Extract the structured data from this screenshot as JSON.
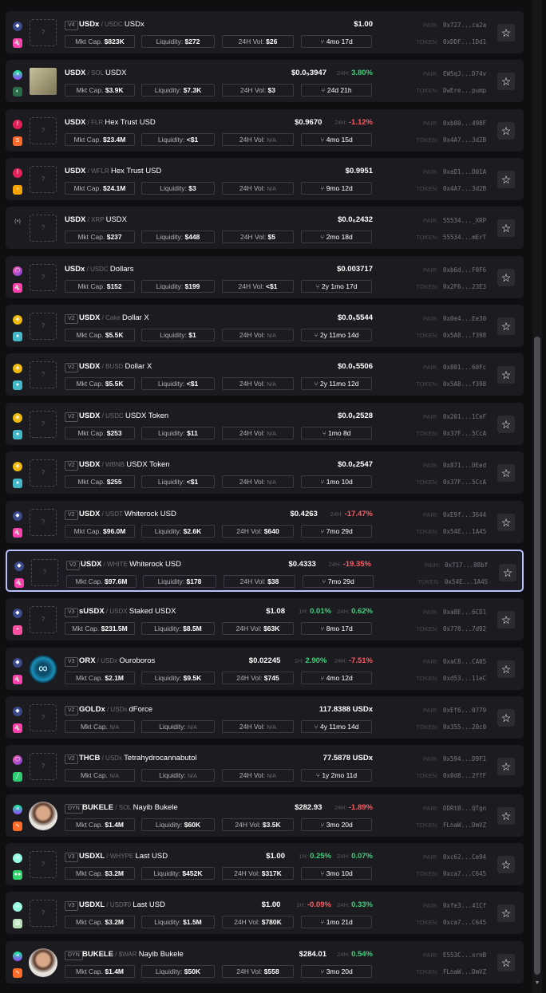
{
  "labels": {
    "mkt_cap": "Mkt Cap.",
    "liquidity": "Liquidity:",
    "vol": "24H Vol:",
    "pair": "PAIR:",
    "token": "TOKEN:",
    "h1": "1H:",
    "h24": "24H:",
    "na": "N/A",
    "separator": "/"
  },
  "colors": {
    "positive": "#3ecf7a",
    "negative": "#ff5b61",
    "selected_border": "#b8c2ff"
  },
  "rows": [
    {
      "chain": "ethereum-icon",
      "dex": "uniswap-icon",
      "logo": "placeholder",
      "version": "V4",
      "base": "USDx",
      "quote": "USDC",
      "name": "USDx",
      "price": "$1.00",
      "h1": null,
      "h24": null,
      "mcap": "$823K",
      "liq": "$272",
      "vol": "$26",
      "age": "4mo 17d",
      "pair": "0x727...ca2a",
      "token": "0xDDF...1Dd1",
      "selected": false
    },
    {
      "chain": "solana-icon",
      "dex": "pumpswap-icon",
      "logo": "banknote-image",
      "version": null,
      "base": "USDX",
      "quote": "SOL",
      "name": "USDX",
      "price": "$0.0₅3947",
      "h1": null,
      "h24": "3.80%",
      "h24_dir": "up",
      "mcap": "$3.9K",
      "liq": "$7.3K",
      "vol": "$3",
      "age": "24d 21h",
      "pair": "EW5qJ...D74v",
      "token": "DwEre...pump",
      "selected": false
    },
    {
      "chain": "flare-icon",
      "dex": "sparkdex-icon",
      "logo": "placeholder",
      "version": null,
      "base": "USDX",
      "quote": "FLR",
      "name": "Hex Trust USD",
      "price": "$0.9670",
      "h1": null,
      "h24": "-1.12%",
      "h24_dir": "down",
      "mcap": "$23.4M",
      "liq": "<$1",
      "vol": "N/A",
      "age": "4mo 15d",
      "pair": "0xb80...498F",
      "token": "0x4A7...3d2B",
      "selected": false
    },
    {
      "chain": "flare-icon",
      "dex": "blazeswap-icon",
      "logo": "placeholder",
      "version": null,
      "base": "USDX",
      "quote": "WFLR",
      "name": "Hex Trust USD",
      "price": "$0.9951",
      "h1": null,
      "h24": null,
      "mcap": "$24.1M",
      "liq": "$3",
      "vol": "N/A",
      "age": "9mo 12d",
      "pair": "0xeD1...D01A",
      "token": "0x4A7...3d2B",
      "selected": false
    },
    {
      "chain": "xrp-icon",
      "dex": null,
      "logo": "placeholder",
      "version": null,
      "base": "USDX",
      "quote": "XRP",
      "name": "USDX",
      "price": "$0.0₆2432",
      "h1": null,
      "h24": null,
      "mcap": "$237",
      "liq": "$448",
      "vol": "$5",
      "age": "2mo 18d",
      "pair": "55534..._XRP",
      "token": "55534...mErT",
      "selected": false
    },
    {
      "chain": "polygon-icon",
      "dex": "uniswap-icon",
      "logo": "placeholder",
      "version": null,
      "base": "USDx",
      "quote": "USDC",
      "name": "Dollars",
      "price": "$0.003717",
      "h1": null,
      "h24": null,
      "mcap": "$152",
      "liq": "$199",
      "vol": "<$1",
      "age": "2y 1mo 17d",
      "pair": "0xb6d...F0F6",
      "token": "0x2F6...23E3",
      "selected": false
    },
    {
      "chain": "bnb-icon",
      "dex": "pancakeswap-icon",
      "logo": "placeholder",
      "version": "V2",
      "base": "USDX",
      "quote": "Cake",
      "name": "Dollar X",
      "price": "$0.0₅5544",
      "h1": null,
      "h24": null,
      "mcap": "$5.5K",
      "liq": "$1",
      "vol": "N/A",
      "age": "2y 11mo 14d",
      "pair": "0x0e4...Ee30",
      "token": "0x5A8...f398",
      "selected": false
    },
    {
      "chain": "bnb-icon",
      "dex": "pancakeswap-icon",
      "logo": "placeholder",
      "version": "V2",
      "base": "USDX",
      "quote": "BUSD",
      "name": "Dollar X",
      "price": "$0.0₅5506",
      "h1": null,
      "h24": null,
      "mcap": "$5.5K",
      "liq": "<$1",
      "vol": "N/A",
      "age": "2y 11mo 12d",
      "pair": "0x801...60Fc",
      "token": "0x5A8...f398",
      "selected": false
    },
    {
      "chain": "bnb-icon",
      "dex": "pancakeswap-icon",
      "logo": "placeholder",
      "version": "V2",
      "base": "USDX",
      "quote": "USDC",
      "name": "USDX Token",
      "price": "$0.0₆2528",
      "h1": null,
      "h24": null,
      "mcap": "$253",
      "liq": "$11",
      "vol": "N/A",
      "age": "1mo 8d",
      "pair": "0x201...1CeF",
      "token": "0x37F...5CcA",
      "selected": false
    },
    {
      "chain": "bnb-icon",
      "dex": "pancakeswap-icon",
      "logo": "placeholder",
      "version": "V2",
      "base": "USDX",
      "quote": "WBNB",
      "name": "USDX Token",
      "price": "$0.0₆2547",
      "h1": null,
      "h24": null,
      "mcap": "$255",
      "liq": "<$1",
      "vol": "N/A",
      "age": "1mo 10d",
      "pair": "0x871...DEed",
      "token": "0x37F...5CcA",
      "selected": false
    },
    {
      "chain": "ethereum-icon",
      "dex": "uniswap-icon",
      "logo": "placeholder",
      "version": "V2",
      "base": "USDX",
      "quote": "USDT",
      "name": "Whiterock USD",
      "price": "$0.4263",
      "h1": null,
      "h24": "-17.47%",
      "h24_dir": "down",
      "mcap": "$96.0M",
      "liq": "$2.6K",
      "vol": "$640",
      "age": "7mo 29d",
      "pair": "0xE9f...3644",
      "token": "0x54E...1A45",
      "selected": false
    },
    {
      "chain": "ethereum-icon",
      "dex": "uniswap-icon",
      "logo": "placeholder",
      "version": "V2",
      "base": "USDX",
      "quote": "WHITE",
      "name": "Whiterock USD",
      "price": "$0.4333",
      "h1": null,
      "h24": "-19.35%",
      "h24_dir": "down",
      "mcap": "$97.6M",
      "liq": "$178",
      "vol": "$38",
      "age": "7mo 29d",
      "pair": "0x717...88bf",
      "token": "0x54E...1A45",
      "selected": true
    },
    {
      "chain": "ethereum-icon",
      "dex": "sushiswap-icon",
      "logo": "placeholder",
      "version": "V3",
      "base": "sUSDX",
      "quote": "USDX",
      "name": "Staked USDX",
      "price": "$1.08",
      "h1": "0.01%",
      "h1_dir": "up",
      "h24": "0.62%",
      "h24_dir": "up",
      "mcap": "$231.5M",
      "liq": "$8.5M",
      "vol": "$63K",
      "age": "8mo 17d",
      "pair": "0xa8E...6CD1",
      "token": "0x778...7d92",
      "selected": false
    },
    {
      "chain": "ethereum-icon",
      "dex": "uniswap-icon",
      "logo": "ouroboros-logo",
      "version": "V3",
      "base": "ORX",
      "quote": "USDx",
      "name": "Ouroboros",
      "price": "$0.02245",
      "h1": "2.90%",
      "h1_dir": "up",
      "h24": "-7.51%",
      "h24_dir": "down",
      "mcap": "$2.1M",
      "liq": "$9.5K",
      "vol": "$745",
      "age": "4mo 12d",
      "pair": "0xaC8...CA05",
      "token": "0xd53...11eC",
      "selected": false
    },
    {
      "chain": "ethereum-icon",
      "dex": "uniswap-icon",
      "logo": "placeholder",
      "version": "V2",
      "base": "GOLDx",
      "quote": "USDx",
      "name": "dForce",
      "price": "117.8388 USDx",
      "h1": null,
      "h24": null,
      "mcap": "N/A",
      "liq": "N/A",
      "vol": "N/A",
      "age": "4y 11mo 14d",
      "pair": "0xEf6...0779",
      "token": "0x355...20c0",
      "selected": false
    },
    {
      "chain": "polygon-icon",
      "dex": "quickswap-icon",
      "logo": "placeholder",
      "version": "V2",
      "base": "THCB",
      "quote": "USDx",
      "name": "Tetrahydrocannabutol",
      "price": "77.5878 USDx",
      "h1": null,
      "h24": null,
      "mcap": "N/A",
      "liq": "N/A",
      "vol": "N/A",
      "age": "1y 2mo 11d",
      "pair": "0x594...D9F1",
      "token": "0x0d8...2ffF",
      "selected": false
    },
    {
      "chain": "solana-icon",
      "dex": "meteora-icon",
      "logo": "bukele-avatar",
      "version": "DYN",
      "base": "BUKELE",
      "quote": "SOL",
      "name": "Nayib Bukele",
      "price": "$282.93",
      "h1": null,
      "h24": "-1.89%",
      "h24_dir": "down",
      "mcap": "$1.4M",
      "liq": "$60K",
      "vol": "$3.5K",
      "age": "3mo 20d",
      "pair": "DDRtB...QTgn",
      "token": "FLnaW...DmVZ",
      "selected": false
    },
    {
      "chain": "hyperevm-icon",
      "dex": "hyperswap-icon",
      "logo": "placeholder",
      "version": "V3",
      "base": "USDXL",
      "quote": "WHYPE",
      "name": "Last USD",
      "price": "$1.00",
      "h1": "0.25%",
      "h1_dir": "up",
      "h24": "0.07%",
      "h24_dir": "up",
      "mcap": "$3.2M",
      "liq": "$452K",
      "vol": "$317K",
      "age": "3mo 10d",
      "pair": "0xc62...Ce94",
      "token": "0xca7...C645",
      "selected": false
    },
    {
      "chain": "hyperevm-icon",
      "dex": "dex-icon",
      "logo": "placeholder",
      "version": "V3",
      "base": "USDXL",
      "quote": "USD₮0",
      "name": "Last USD",
      "price": "$1.00",
      "h1": "-0.09%",
      "h1_dir": "down",
      "h24": "0.33%",
      "h24_dir": "up",
      "mcap": "$3.2M",
      "liq": "$1.5M",
      "vol": "$780K",
      "age": "1mo 21d",
      "pair": "0xfe3...41Cf",
      "token": "0xca7...C645",
      "selected": false
    },
    {
      "chain": "solana-icon",
      "dex": "meteora-icon",
      "logo": "bukele-avatar",
      "version": "DYN",
      "base": "BUKELE",
      "quote": "$WAR",
      "name": "Nayib Bukele",
      "price": "$284.01",
      "h1": null,
      "h24": "0.54%",
      "h24_dir": "up",
      "mcap": "$1.4M",
      "liq": "$50K",
      "vol": "$558",
      "age": "3mo 20d",
      "pair": "E553C...xrnB",
      "token": "FLnaW...DmVZ",
      "selected": false
    }
  ]
}
